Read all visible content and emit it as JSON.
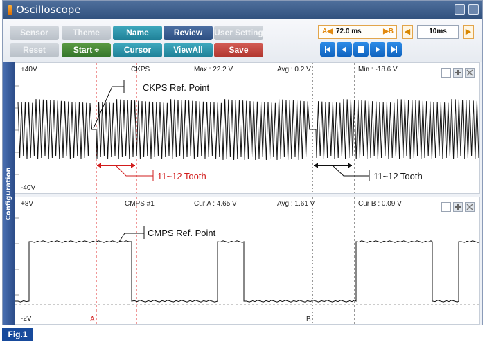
{
  "window": {
    "title": "Oscilloscope"
  },
  "toolbar": {
    "row1": [
      "Sensor",
      "Theme",
      "Name",
      "Review",
      "User Setting"
    ],
    "row2": [
      "Reset",
      "Start",
      "Cursor",
      "ViewAll",
      "Save"
    ],
    "start_arrow": "÷",
    "time_a": "A◀",
    "time_value": "72.0 ms",
    "time_b": "▶B",
    "time_div": "10ms"
  },
  "side_tab": "Configuration",
  "ckps": {
    "top_label": "+40V",
    "bottom_label": "-40V",
    "name": "CKPS",
    "max": "Max : 22.2 V",
    "avg": "Avg : 0.2 V",
    "min": "Min : -18.6 V",
    "ref_label": "CKPS Ref. Point",
    "tooth_a": "11~12 Tooth",
    "tooth_b": "11~12 Tooth"
  },
  "cmps": {
    "top_label": "+8V",
    "bottom_label": "-2V",
    "name": "CMPS #1",
    "cur_a": "Cur A : 4.65 V",
    "avg": "Avg : 1.61 V",
    "cur_b": "Cur B : 0.09 V",
    "ref_label": "CMPS Ref. Point",
    "cursor_a": "A",
    "cursor_b": "B"
  },
  "figure_label": "Fig.1",
  "colors": {
    "accent": "#d21c1c",
    "titlebar": "#3b5b8a"
  }
}
